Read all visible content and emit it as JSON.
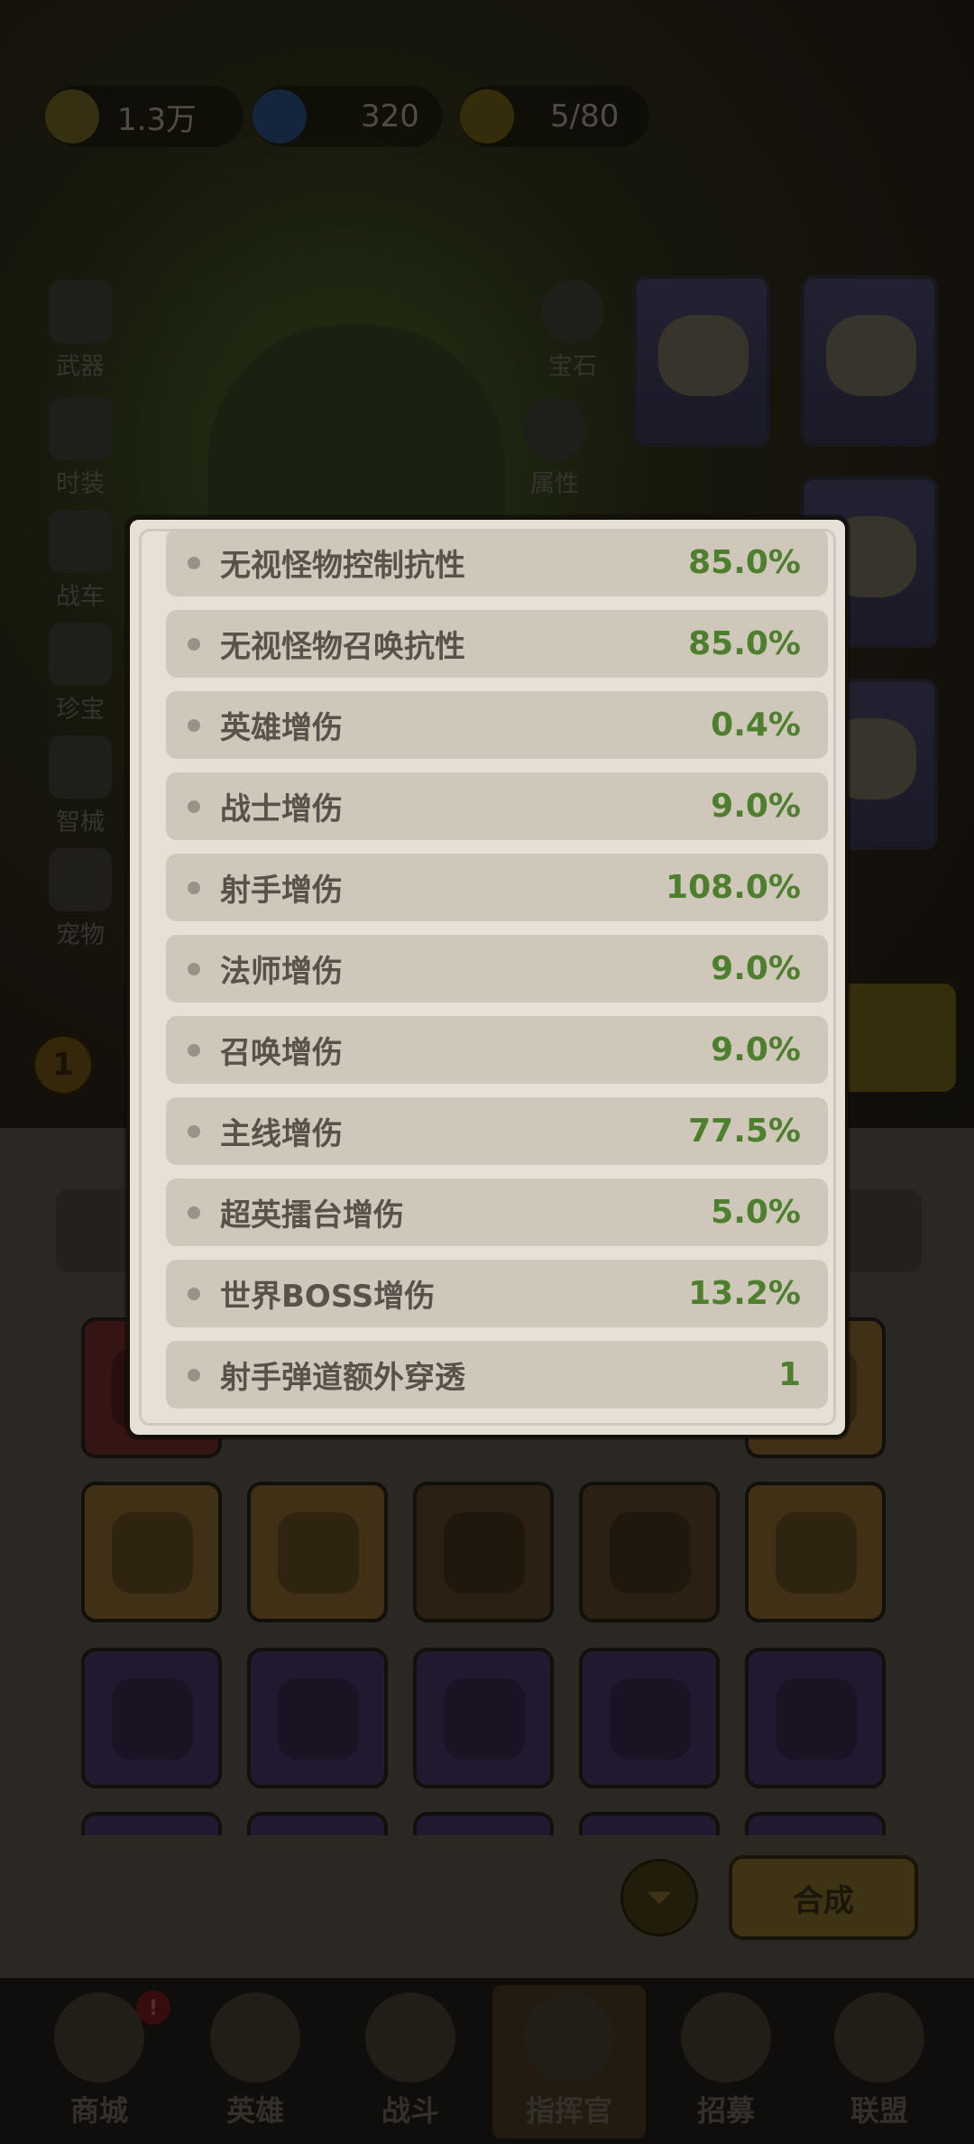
{
  "resources": {
    "gold": "1.3万",
    "diamond": "320",
    "energy": "5/80"
  },
  "side_menu": [
    "武器",
    "时装",
    "战车",
    "珍宝",
    "智械",
    "宠物"
  ],
  "gem_button": "宝石",
  "attr_button": "属性",
  "level_badge": "1",
  "merge_button": "合成",
  "bottom_nav": [
    "商城",
    "英雄",
    "战斗",
    "指挥官",
    "招募",
    "联盟"
  ],
  "bottom_nav_active": "指挥官",
  "attributes": [
    {
      "name": "无视怪物控制抗性",
      "value": "85.0%"
    },
    {
      "name": "无视怪物召唤抗性",
      "value": "85.0%"
    },
    {
      "name": "英雄增伤",
      "value": "0.4%"
    },
    {
      "name": "战士增伤",
      "value": "9.0%"
    },
    {
      "name": "射手增伤",
      "value": "108.0%"
    },
    {
      "name": "法师增伤",
      "value": "9.0%"
    },
    {
      "name": "召唤增伤",
      "value": "9.0%"
    },
    {
      "name": "主线增伤",
      "value": "77.5%"
    },
    {
      "name": "超英擂台增伤",
      "value": "5.0%"
    },
    {
      "name": "世界BOSS增伤",
      "value": "13.2%"
    },
    {
      "name": "射手弹道额外穿透",
      "value": "1"
    }
  ],
  "colors": {
    "value_green": "#4e7f2e",
    "row_bg": "#d0c7bb",
    "modal_bg": "#e6e0d6"
  }
}
